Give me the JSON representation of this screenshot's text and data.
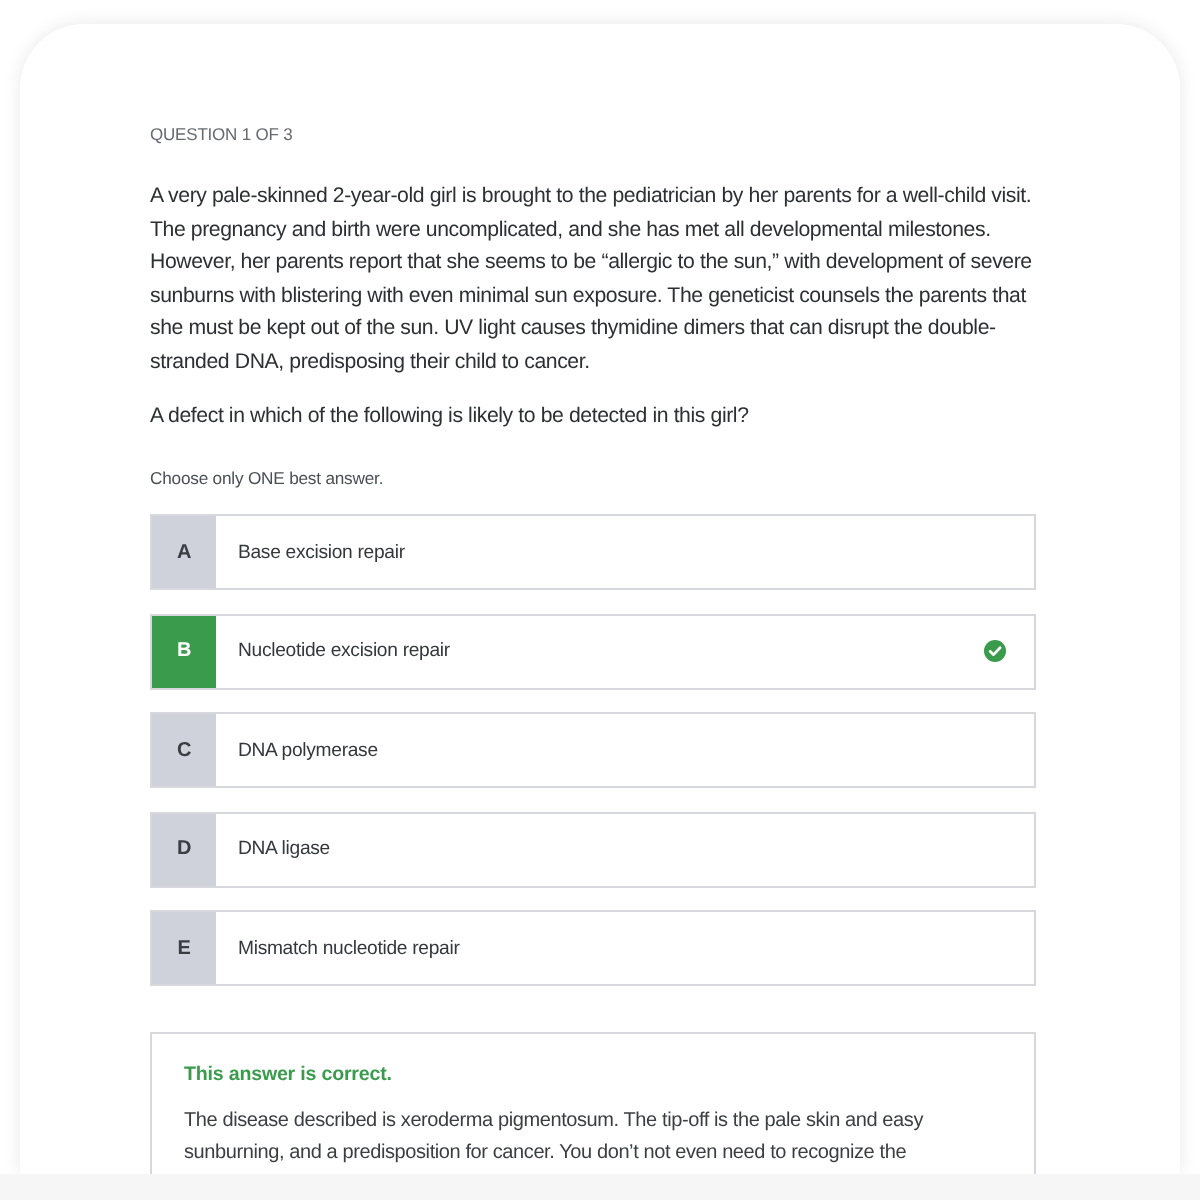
{
  "question_label": "QUESTION 1 OF 3",
  "stem": "A very pale-skinned 2-year-old girl is brought to the pediatrician by her parents for a well-child visit. The pregnancy and birth were uncomplicated, and she has met all developmental milestones. However, her parents report that she seems to be “allergic to the sun,” with development of severe sunburns with blistering with even minimal sun exposure. The geneticist counsels the parents that she must be kept out of the sun. UV light causes thymidine dimers that can disrupt the double-stranded DNA, predisposing their child to cancer.",
  "prompt": "A defect in which of the following is likely to be detected in this girl?",
  "instruction": "Choose only ONE best answer.",
  "options": [
    {
      "letter": "A",
      "text": "Base excision repair",
      "selected": false,
      "correct": false
    },
    {
      "letter": "B",
      "text": "Nucleotide excision repair",
      "selected": true,
      "correct": true
    },
    {
      "letter": "C",
      "text": "DNA polymerase",
      "selected": false,
      "correct": false
    },
    {
      "letter": "D",
      "text": "DNA ligase",
      "selected": false,
      "correct": false
    },
    {
      "letter": "E",
      "text": "Mismatch nucleotide repair",
      "selected": false,
      "correct": false
    }
  ],
  "feedback": {
    "correct": true,
    "title": "This answer is correct.",
    "body": "The disease described is xeroderma pigmentosum. The tip-off is the pale skin and easy sunburning, and a predisposition for cancer. You don’t not even need to recognize the"
  }
}
